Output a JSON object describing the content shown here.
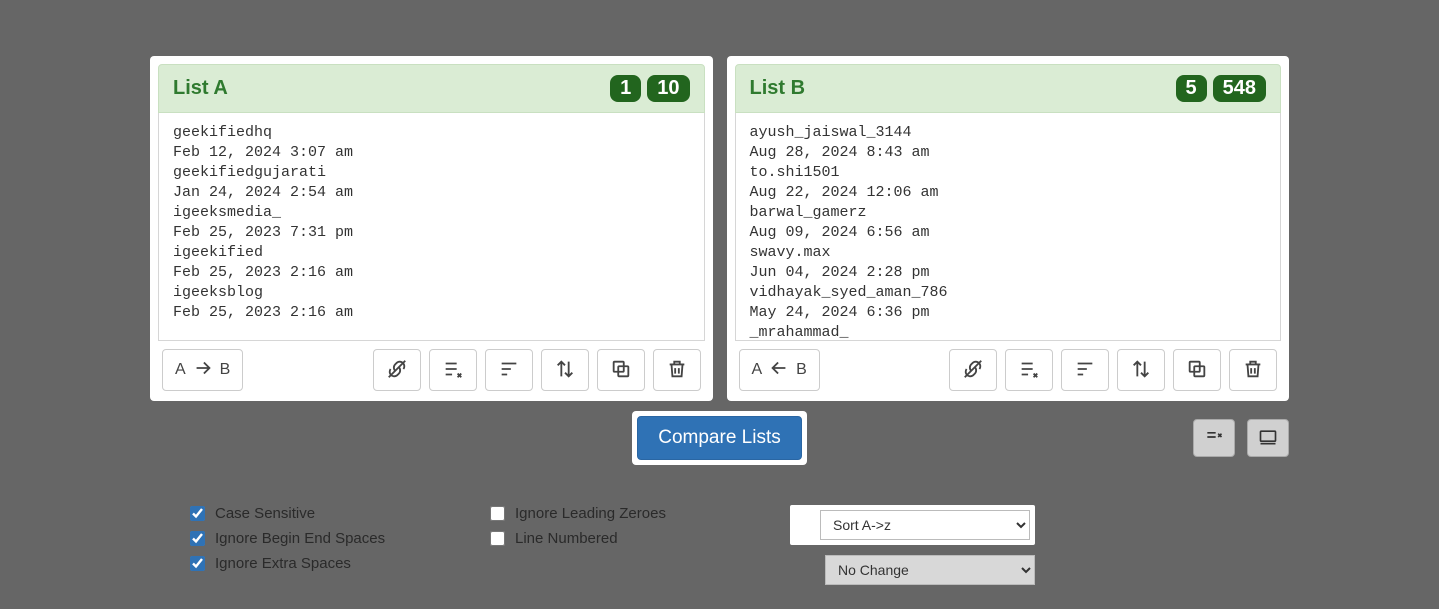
{
  "listA": {
    "title": "List A",
    "badge1": "1",
    "badge2": "10",
    "content": "geekifiedhq\nFeb 12, 2024 3:07 am\ngeekifiedgujarati\nJan 24, 2024 2:54 am\nigeeksmedia_\nFeb 25, 2023 7:31 pm\nigeekified\nFeb 25, 2023 2:16 am\nigeeksblog\nFeb 25, 2023 2:16 am",
    "ab_left": "A",
    "ab_right": "B"
  },
  "listB": {
    "title": "List B",
    "badge1": "5",
    "badge2": "548",
    "content": "ayush_jaiswal_3144\nAug 28, 2024 8:43 am\nto.shi1501\nAug 22, 2024 12:06 am\nbarwal_gamerz\nAug 09, 2024 6:56 am\nswavy.max\nJun 04, 2024 2:28 pm\nvidhayak_syed_aman_786\nMay 24, 2024 6:36 pm\n_mrahammad_",
    "ab_left": "A",
    "ab_right": "B"
  },
  "compare": {
    "label": "Compare Lists"
  },
  "options": {
    "case_sensitive": "Case Sensitive",
    "ignore_begin_end": "Ignore Begin End Spaces",
    "ignore_extra": "Ignore Extra Spaces",
    "ignore_zero": "Ignore Leading Zeroes",
    "line_numbered": "Line Numbered",
    "sort_selected": "Sort A->z",
    "change_selected": "No Change"
  }
}
